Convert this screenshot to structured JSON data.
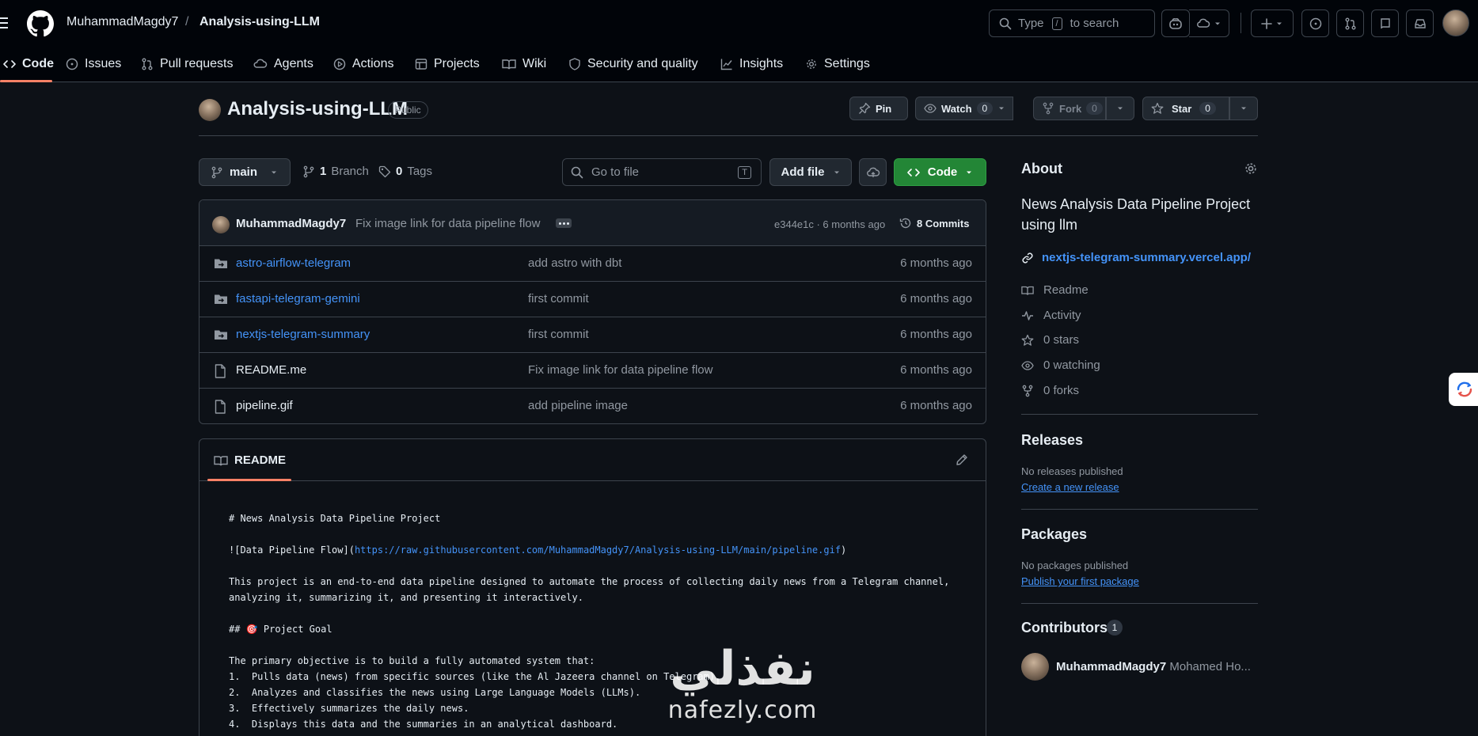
{
  "header": {
    "owner": "MuhammadMagdy7",
    "separator": "/",
    "repo": "Analysis-using-LLM",
    "search": {
      "prefix": "Type",
      "key": "/",
      "suffix": "to search"
    }
  },
  "nav": {
    "tabs": [
      {
        "label": "Code",
        "icon": "code-icon"
      },
      {
        "label": "Issues",
        "icon": "issue-icon"
      },
      {
        "label": "Pull requests",
        "icon": "pull-request-icon"
      },
      {
        "label": "Agents",
        "icon": "agents-icon"
      },
      {
        "label": "Actions",
        "icon": "play-icon"
      },
      {
        "label": "Projects",
        "icon": "table-icon"
      },
      {
        "label": "Wiki",
        "icon": "book-icon"
      },
      {
        "label": "Security and quality",
        "icon": "shield-icon"
      },
      {
        "label": "Insights",
        "icon": "graph-icon"
      },
      {
        "label": "Settings",
        "icon": "gear-icon"
      }
    ]
  },
  "repo_header": {
    "title": "Analysis-using-LLM",
    "visibility": "Public",
    "pin": "Pin",
    "watch": {
      "label": "Watch",
      "count": "0"
    },
    "fork": {
      "label": "Fork",
      "count": "0"
    },
    "star": {
      "label": "Star",
      "count": "0"
    }
  },
  "branch_bar": {
    "branch": "main",
    "branches_count": "1",
    "branches_label": "Branch",
    "tags_count": "0",
    "tags_label": "Tags",
    "go_to_file_placeholder": "Go to file",
    "go_to_file_key": "T",
    "add_file": "Add file",
    "code": "Code"
  },
  "latest_commit": {
    "author": "MuhammadMagdy7",
    "message": "Fix image link for data pipeline flow",
    "sha_time": "e344e1c · 6 months ago",
    "commits": "8 Commits"
  },
  "files": [
    {
      "name": "astro-airflow-telegram",
      "type": "dir",
      "message": "add astro with dbt",
      "date": "6 months ago"
    },
    {
      "name": "fastapi-telegram-gemini",
      "type": "dir",
      "message": "first commit",
      "date": "6 months ago"
    },
    {
      "name": "nextjs-telegram-summary",
      "type": "dir",
      "message": "first commit",
      "date": "6 months ago"
    },
    {
      "name": "README.me",
      "type": "file",
      "message": "Fix image link for data pipeline flow",
      "date": "6 months ago"
    },
    {
      "name": "pipeline.gif",
      "type": "file",
      "message": "add pipeline image",
      "date": "6 months ago"
    }
  ],
  "readme": {
    "tab": "README",
    "line1": "# News Analysis Data Pipeline Project",
    "img_prefix": "![Data Pipeline Flow](",
    "img_url": "https://raw.githubusercontent.com/MuhammadMagdy7/Analysis-using-LLM/main/pipeline.gif",
    "img_suffix": ")",
    "para1": "This project is an end-to-end data pipeline designed to automate the process of collecting daily news from a Telegram channel,",
    "para2": "analyzing it, summarizing it, and presenting it interactively.",
    "goal_prefix": "## ",
    "goal_emoji": "🎯",
    "goal_text": " Project Goal",
    "objective": "The primary objective is to build a fully automated system that:",
    "item1": "1.  Pulls data (news) from specific sources (like the Al Jazeera channel on Telegram).",
    "item2": "2.  Analyzes and classifies the news using Large Language Models (LLMs).",
    "item3": "3.  Effectively summarizes the daily news.",
    "item4": "4.  Displays this data and the summaries in an analytical dashboard."
  },
  "sidebar": {
    "about_title": "About",
    "description": "News Analysis Data Pipeline Project using llm",
    "website": "nextjs-telegram-summary.vercel.app/",
    "items": [
      {
        "label": "Readme",
        "icon": "book-icon"
      },
      {
        "label": "Activity",
        "icon": "pulse-icon"
      },
      {
        "label": "0 stars",
        "icon": "star-icon"
      },
      {
        "label": "0 watching",
        "icon": "eye-icon"
      },
      {
        "label": "0 forks",
        "icon": "fork-icon"
      }
    ],
    "releases_title": "Releases",
    "releases_empty": "No releases published",
    "releases_link": "Create a new release",
    "packages_title": "Packages",
    "packages_empty": "No packages published",
    "packages_link": "Publish your first package",
    "contributors_title": "Contributors",
    "contributors_count": "1",
    "contributor_login": "MuhammadMagdy7",
    "contributor_name": "Mohamed Ho..."
  },
  "watermark": {
    "arabic": "نفذلي",
    "latin": "nafezly.com"
  },
  "colors": {
    "accent_green": "#238636",
    "link_blue": "#4493f8",
    "tab_underline": "#f78166",
    "bg": "#0d1117"
  }
}
